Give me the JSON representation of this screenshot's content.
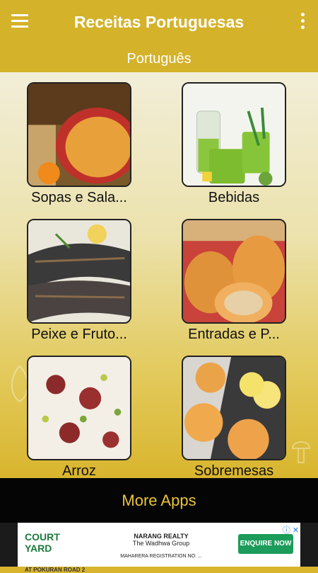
{
  "appbar": {
    "title": "Receitas Portuguesas"
  },
  "language": "Português",
  "categories": [
    {
      "label": "Sopas e Sala..."
    },
    {
      "label": "Bebidas"
    },
    {
      "label": "Peixe e Fruto..."
    },
    {
      "label": "Entradas e P..."
    },
    {
      "label": "Arroz"
    },
    {
      "label": "Sobremesas"
    }
  ],
  "footer": {
    "button_label": "More Apps"
  },
  "ad": {
    "brand_line1": "COURT YARD",
    "brand_line2": "AT POKURAN ROAD 2",
    "realty": "NARANG REALTY",
    "group": "The Wadhwa Group",
    "reg": "MAHARERA REGISTRATION NO: ...",
    "cta": "ENQUIRE NOW",
    "close": "ⓘ ✕"
  },
  "colors": {
    "accent": "#d4b22a",
    "footer_bg": "#050505",
    "footer_text": "#e8c53a"
  }
}
